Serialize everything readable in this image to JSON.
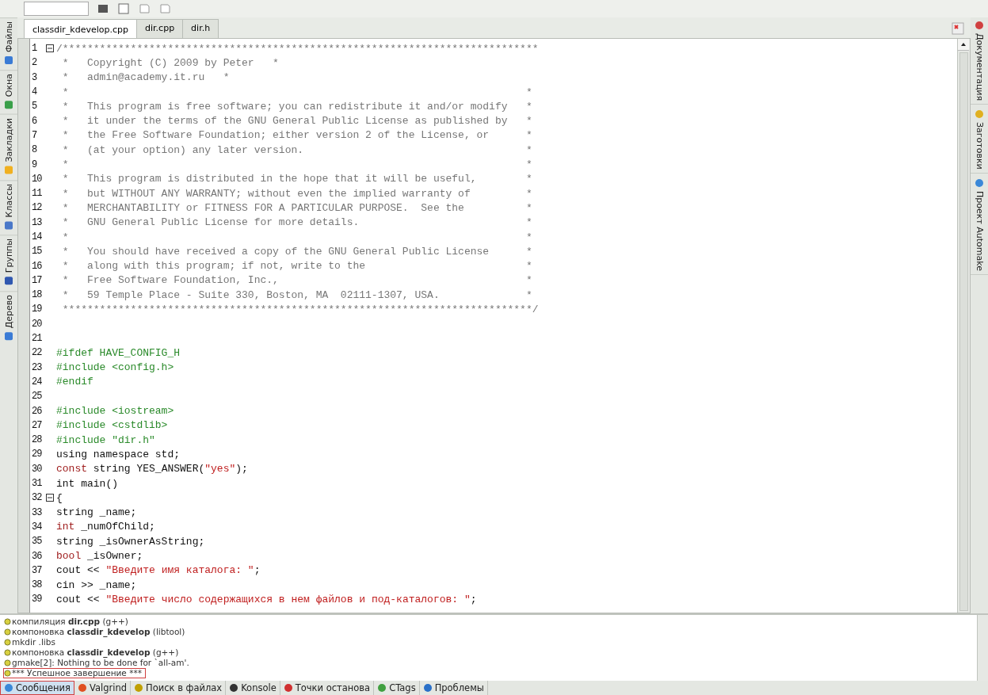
{
  "editor_tabs": [
    {
      "label": "classdir_kdevelop.cpp",
      "selected": true
    },
    {
      "label": "dir.cpp",
      "selected": false
    },
    {
      "label": "dir.h",
      "selected": false
    }
  ],
  "left_dock": [
    {
      "label": "Файлы"
    },
    {
      "label": "Окна"
    },
    {
      "label": "Закладки"
    },
    {
      "label": "Классы"
    },
    {
      "label": "Группы"
    },
    {
      "label": "Дерево"
    }
  ],
  "right_dock": [
    {
      "label": "Документация"
    },
    {
      "label": "Заготовки"
    },
    {
      "label": "Проект Automake"
    }
  ],
  "code_lines": [
    {
      "number": "1",
      "fold": true,
      "segments": [
        {
          "kind": "comment",
          "text": "/*****************************************************************************"
        }
      ]
    },
    {
      "number": "2",
      "fold": false,
      "segments": [
        {
          "kind": "comment",
          "text": " *   Copyright (C) 2009 by Peter   *"
        }
      ]
    },
    {
      "number": "3",
      "fold": false,
      "segments": [
        {
          "kind": "comment",
          "text": " *   admin@academy.it.ru   *"
        }
      ]
    },
    {
      "number": "4",
      "fold": false,
      "segments": [
        {
          "kind": "comment-box",
          "text": " *"
        },
        {
          "kind": "comment",
          "text": "*"
        }
      ]
    },
    {
      "number": "5",
      "fold": false,
      "segments": [
        {
          "kind": "comment-box",
          "text": " *   This program is free software; you can redistribute it and/or modify"
        },
        {
          "kind": "comment",
          "text": "*"
        }
      ]
    },
    {
      "number": "6",
      "fold": false,
      "segments": [
        {
          "kind": "comment-box",
          "text": " *   it under the terms of the GNU General Public License as published by"
        },
        {
          "kind": "comment",
          "text": "*"
        }
      ]
    },
    {
      "number": "7",
      "fold": false,
      "segments": [
        {
          "kind": "comment-box",
          "text": " *   the Free Software Foundation; either version 2 of the License, or"
        },
        {
          "kind": "comment",
          "text": "*"
        }
      ]
    },
    {
      "number": "8",
      "fold": false,
      "segments": [
        {
          "kind": "comment-box",
          "text": " *   (at your option) any later version."
        },
        {
          "kind": "comment",
          "text": "*"
        }
      ]
    },
    {
      "number": "9",
      "fold": false,
      "segments": [
        {
          "kind": "comment-box",
          "text": " *"
        },
        {
          "kind": "comment",
          "text": "*"
        }
      ]
    },
    {
      "number": "10",
      "fold": false,
      "segments": [
        {
          "kind": "comment-box",
          "text": " *   This program is distributed in the hope that it will be useful,"
        },
        {
          "kind": "comment",
          "text": "*"
        }
      ]
    },
    {
      "number": "11",
      "fold": false,
      "segments": [
        {
          "kind": "comment-box",
          "text": " *   but WITHOUT ANY WARRANTY; without even the implied warranty of"
        },
        {
          "kind": "comment",
          "text": "*"
        }
      ]
    },
    {
      "number": "12",
      "fold": false,
      "segments": [
        {
          "kind": "comment-box",
          "text": " *   MERCHANTABILITY or FITNESS FOR A PARTICULAR PURPOSE.  See the"
        },
        {
          "kind": "comment",
          "text": "*"
        }
      ]
    },
    {
      "number": "13",
      "fold": false,
      "segments": [
        {
          "kind": "comment-box",
          "text": " *   GNU General Public License for more details."
        },
        {
          "kind": "comment",
          "text": "*"
        }
      ]
    },
    {
      "number": "14",
      "fold": false,
      "segments": [
        {
          "kind": "comment-box",
          "text": " *"
        },
        {
          "kind": "comment",
          "text": "*"
        }
      ]
    },
    {
      "number": "15",
      "fold": false,
      "segments": [
        {
          "kind": "comment-box",
          "text": " *   You should have received a copy of the GNU General Public License"
        },
        {
          "kind": "comment",
          "text": "*"
        }
      ]
    },
    {
      "number": "16",
      "fold": false,
      "segments": [
        {
          "kind": "comment-box",
          "text": " *   along with this program; if not, write to the"
        },
        {
          "kind": "comment",
          "text": "*"
        }
      ]
    },
    {
      "number": "17",
      "fold": false,
      "segments": [
        {
          "kind": "comment-box",
          "text": " *   Free Software Foundation, Inc.,"
        },
        {
          "kind": "comment",
          "text": "*"
        }
      ]
    },
    {
      "number": "18",
      "fold": false,
      "segments": [
        {
          "kind": "comment-box",
          "text": " *   59 Temple Place - Suite 330, Boston, MA  02111-1307, USA."
        },
        {
          "kind": "comment",
          "text": "*"
        }
      ]
    },
    {
      "number": "19",
      "fold": false,
      "segments": [
        {
          "kind": "comment",
          "text": " ****************************************************************************/"
        }
      ]
    },
    {
      "number": "20",
      "fold": false
    },
    {
      "number": "21",
      "fold": false
    },
    {
      "number": "22",
      "fold": false,
      "segments": [
        {
          "kind": "preproc",
          "text": "#ifdef HAVE_CONFIG_H"
        }
      ]
    },
    {
      "number": "23",
      "fold": false,
      "segments": [
        {
          "kind": "preproc",
          "text": "#include <config.h>"
        }
      ]
    },
    {
      "number": "24",
      "fold": false,
      "segments": [
        {
          "kind": "preproc",
          "text": "#endif"
        }
      ]
    },
    {
      "number": "25",
      "fold": false
    },
    {
      "number": "26",
      "fold": false,
      "segments": [
        {
          "kind": "preproc",
          "text": "#include <iostream>"
        }
      ]
    },
    {
      "number": "27",
      "fold": false,
      "segments": [
        {
          "kind": "preproc",
          "text": "#include <cstdlib>"
        }
      ]
    },
    {
      "number": "28",
      "fold": false,
      "segments": [
        {
          "kind": "preproc",
          "text": "#include \"dir.h\""
        }
      ]
    },
    {
      "number": "29",
      "fold": false,
      "segments": [
        {
          "kind": "plain",
          "text": "using namespace std;"
        }
      ]
    },
    {
      "number": "30",
      "fold": false,
      "segments": [
        {
          "kind": "keyword",
          "text": "const"
        },
        {
          "kind": "plain",
          "text": " string YES_ANSWER("
        },
        {
          "kind": "string",
          "text": "\"yes\""
        },
        {
          "kind": "plain",
          "text": ");"
        }
      ]
    },
    {
      "number": "31",
      "fold": false,
      "segments": [
        {
          "kind": "plain",
          "text": "int main()"
        }
      ]
    },
    {
      "number": "32",
      "fold": true,
      "segments": [
        {
          "kind": "plain",
          "text": "{"
        }
      ]
    },
    {
      "number": "33",
      "fold": false,
      "segments": [
        {
          "kind": "plain",
          "text": "string _name;"
        }
      ]
    },
    {
      "number": "34",
      "fold": false,
      "segments": [
        {
          "kind": "keyword",
          "text": "int"
        },
        {
          "kind": "plain",
          "text": " _numOfChild;"
        }
      ]
    },
    {
      "number": "35",
      "fold": false,
      "segments": [
        {
          "kind": "plain",
          "text": "string _isOwnerAsString;"
        }
      ]
    },
    {
      "number": "36",
      "fold": false,
      "segments": [
        {
          "kind": "keyword",
          "text": "bool"
        },
        {
          "kind": "plain",
          "text": " _isOwner;"
        }
      ]
    },
    {
      "number": "37",
      "fold": false,
      "segments": [
        {
          "kind": "plain",
          "text": "cout << "
        },
        {
          "kind": "string",
          "text": "\"Введите имя каталога: \""
        },
        {
          "kind": "plain",
          "text": ";"
        }
      ]
    },
    {
      "number": "38",
      "fold": false,
      "segments": [
        {
          "kind": "plain",
          "text": "cin >> _name;"
        }
      ]
    },
    {
      "number": "39",
      "fold": false,
      "segments": [
        {
          "kind": "plain",
          "text": "cout << "
        },
        {
          "kind": "string",
          "text": "\"Введите число содержащихся в нем файлов и под-каталогов: \""
        },
        {
          "kind": "plain",
          "text": ";"
        }
      ]
    }
  ],
  "messages": [
    {
      "kind": "rich",
      "text": "компиляция **dir.cpp** (g++)",
      "selected": false
    },
    {
      "kind": "rich",
      "text": "компоновка **classdir_kdevelop** (libtool)",
      "selected": false
    },
    {
      "kind": "plain",
      "text": "mkdir .libs",
      "selected": false
    },
    {
      "kind": "rich",
      "text": "компоновка **classdir_kdevelop** (g++)",
      "selected": false
    },
    {
      "kind": "plain",
      "text": "gmake[2]: Nothing to be done for `all-am'.",
      "selected": false
    },
    {
      "kind": "plain",
      "text": "*** Успешное завершение ***",
      "selected": true
    }
  ],
  "bottom_tabs": [
    {
      "label": "Сообщения",
      "selected": true
    },
    {
      "label": "Valgrind",
      "selected": false
    },
    {
      "label": "Поиск в файлах",
      "selected": false
    },
    {
      "label": "Konsole",
      "selected": false
    },
    {
      "label": "Точки останова",
      "selected": false
    },
    {
      "label": "CTags",
      "selected": false
    },
    {
      "label": "Проблемы",
      "selected": false
    }
  ]
}
